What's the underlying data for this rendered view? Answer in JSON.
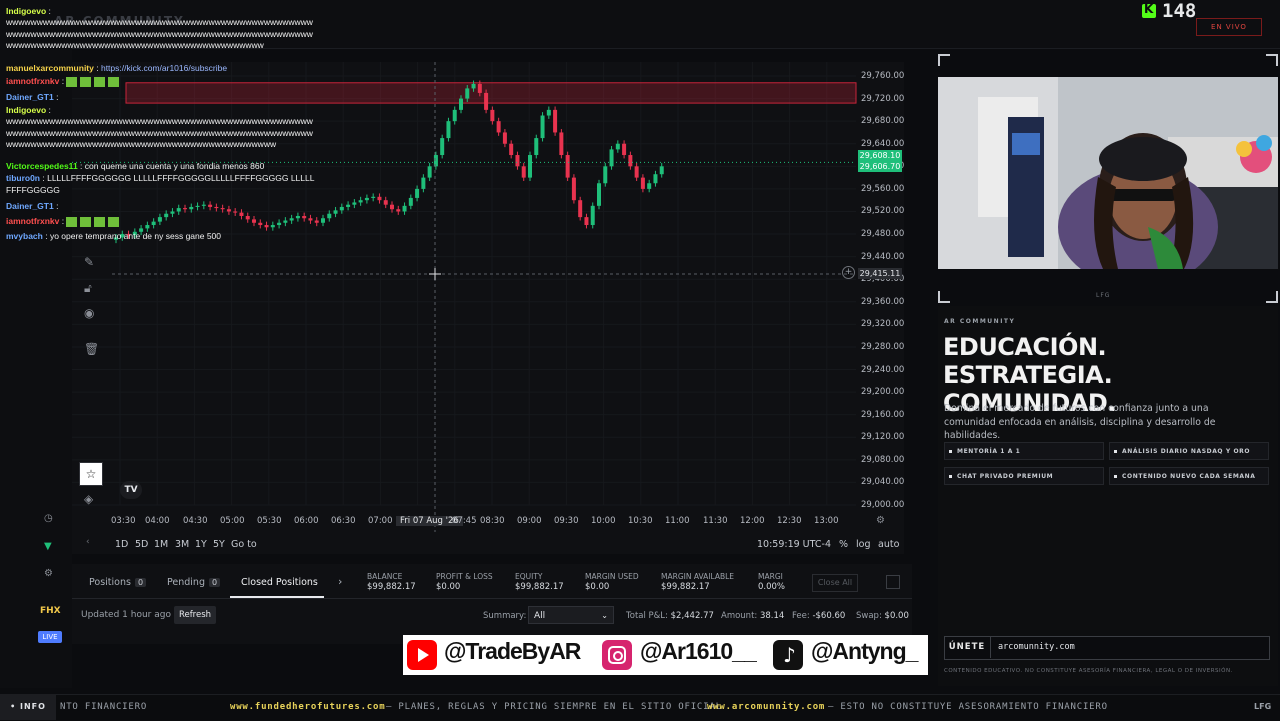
{
  "header": {
    "brand_faint": "AR COMMUNITY",
    "viewer_count": "148",
    "live_badge": "EN VIVO"
  },
  "chat": [
    {
      "user": "Indigoevo",
      "color": "#d7ff4a",
      "msg": ""
    },
    {
      "user": "",
      "color": "#ffffff",
      "msg": "wwwwwwwwwwwwwwwwwwwwwwwwwwwwwwwwwwwwwwwwwwwwwwwwwwwwwwwwwwwwwwwwwwwwwwwwwwwwwwwwwwwwwwwwwwwwwwwwwwwwwwwwwwwwwwwwwwwwwwwwwwwwwwwwwwwwwwwwwwwwww"
    },
    {
      "user": "manuelxarcommunity",
      "color": "#f5d24a",
      "msg": "https://kick.com/ar1016/subscribe"
    },
    {
      "user": "iamnotfrxnkv",
      "color": "#ff4f4f",
      "msg": "emotes"
    },
    {
      "user": "Dainer_GT1",
      "color": "#6fa8ff",
      "msg": ""
    },
    {
      "user": "Indigoevo",
      "color": "#d7ff4a",
      "msg": ""
    },
    {
      "user": "",
      "color": "#ffffff",
      "msg": "wwwwwwwwwwwwwwwwwwwwwwwwwwwwwwwwwwwwwwwwwwwwwwwwwwwwwwwwwwwwwwwwwwwwwwwwwwwwwwwwwwwwwwwwwwwwwwwwwwwwwwwwwwwwwwwwwwwwwwwwwwwwwwwwwwwwwwwwwwwwwwww"
    },
    {
      "user": "Victorcespedes11",
      "color": "#53fc18",
      "msg": "con queme una cuenta y una fondia menos 860"
    },
    {
      "user": "tiburo0n",
      "color": "#6fa8ff",
      "msg": "LLLLLFFFFGGGGGG LLLLLFFFFGGGGGLLLLLFFFFGGGGG LLLLLFFFFGGGGG"
    },
    {
      "user": "Dainer_GT1",
      "color": "#6fa8ff",
      "msg": ""
    },
    {
      "user": "iamnotfrxnkv",
      "color": "#ff4f4f",
      "msg": "emotes"
    },
    {
      "user": "mvybach",
      "color": "#6fa8ff",
      "msg": "yo opere temprano ante de ny sess gane 500"
    }
  ],
  "chart_data": {
    "type": "candlestick",
    "x_ticks": [
      "03:30",
      "04:00",
      "04:30",
      "05:00",
      "05:30",
      "06:00",
      "06:30",
      "07:00",
      "Fri 07 Aug '26",
      "07:45",
      "08:30",
      "09:00",
      "09:30",
      "10:00",
      "10:30",
      "11:00",
      "11:30",
      "12:00",
      "12:30",
      "13:00"
    ],
    "y_ticks": [
      "29,760.00",
      "29,720.00",
      "29,680.00",
      "29,640.00",
      "29,600.00",
      "29,560.00",
      "29,520.00",
      "29,480.00",
      "29,440.00",
      "29,400.00",
      "29,360.00",
      "29,320.00",
      "29,280.00",
      "29,240.00",
      "29,200.00",
      "29,160.00",
      "29,120.00",
      "29,080.00",
      "29,040.00",
      "29,000.00"
    ],
    "ylim": [
      29000,
      29760
    ],
    "price_badges": [
      "29,608.10",
      "29,606.70"
    ],
    "crosshair_price": "29,415.11",
    "zone": [
      29712,
      29748
    ],
    "colors": {
      "up": "#1fbf7a",
      "down": "#e8334f",
      "zone": "#c8243a"
    },
    "closes": [
      29474,
      29480,
      29478,
      29484,
      29490,
      29496,
      29502,
      29510,
      29516,
      29520,
      29526,
      29524,
      29528,
      29530,
      29532,
      29528,
      29526,
      29524,
      29520,
      29518,
      29512,
      29506,
      29500,
      29496,
      29492,
      29496,
      29500,
      29504,
      29508,
      29512,
      29508,
      29504,
      29500,
      29508,
      29516,
      29522,
      29528,
      29532,
      29536,
      29540,
      29544,
      29546,
      29540,
      29532,
      29524,
      29520,
      29530,
      29544,
      29560,
      29580,
      29600,
      29620,
      29650,
      29680,
      29700,
      29720,
      29738,
      29746,
      29730,
      29700,
      29680,
      29660,
      29640,
      29620,
      29600,
      29580,
      29620,
      29650,
      29690,
      29700,
      29660,
      29620,
      29580,
      29540,
      29510,
      29496,
      29530,
      29570,
      29600,
      29630,
      29640,
      29620,
      29600,
      29580,
      29560,
      29570,
      29586,
      29600
    ]
  },
  "toolbar": {
    "ranges": [
      "1D",
      "5D",
      "1M",
      "3M",
      "1Y",
      "5Y"
    ],
    "goto": "Go to",
    "clock": "10:59:19 UTC-4",
    "pct": "%",
    "log": "log",
    "auto": "auto"
  },
  "panel": {
    "tabs": [
      {
        "label": "Positions",
        "count": "0"
      },
      {
        "label": "Pending",
        "count": "0"
      },
      {
        "label": "Closed Positions",
        "count": ""
      }
    ],
    "stats": [
      {
        "label": "BALANCE",
        "value": "$99,882.17"
      },
      {
        "label": "PROFIT & LOSS",
        "value": "$0.00"
      },
      {
        "label": "EQUITY",
        "value": "$99,882.17"
      },
      {
        "label": "MARGIN USED",
        "value": "$0.00"
      },
      {
        "label": "MARGIN AVAILABLE",
        "value": "$99,882.17"
      },
      {
        "label": "MARGI",
        "value": "0.00%"
      }
    ],
    "close_all": "Close All",
    "updated": "Updated 1 hour ago",
    "refresh": "Refresh",
    "summary_label": "Summary:",
    "summary_value": "All",
    "total_pl_label": "Total P&L:",
    "total_pl": "$2,442.77",
    "amount_label": "Amount:",
    "amount": "38.14",
    "fee_label": "Fee:",
    "fee": "-$60.60",
    "swap_label": "Swap:",
    "swap": "$0.00"
  },
  "left_badges": {
    "fhx": "FHX",
    "live": "LIVE"
  },
  "socials": [
    {
      "handle": "@TradeByAR",
      "icon": "youtube-icon",
      "color": "#ff0000"
    },
    {
      "handle": "@Ar1610__",
      "icon": "instagram-icon",
      "color": "#d6246e"
    },
    {
      "handle": "@Antyng_",
      "icon": "tiktok-icon",
      "color": "#111111"
    }
  ],
  "promo": {
    "small_top": "LFG",
    "tag": "AR COMMUNITY",
    "title_line1": "EDUCACIÓN. ESTRATEGIA.",
    "title_line2": "COMUNIDAD.",
    "desc": "Domina el mercado de futuros con confianza junto a una comunidad enfocada en análisis, disciplina y desarrollo de habilidades.",
    "features": [
      "MENTORÍA 1 A 1",
      "ANÁLISIS DIARIO NASDAQ Y ORO",
      "CHAT PRIVADO PREMIUM",
      "CONTENIDO NUEVO CADA SEMANA"
    ],
    "join_label": "ÚNETE",
    "join_url": "arcomunnity.com",
    "disclaimer": "CONTENIDO EDUCATIVO. NO CONSTITUYE ASESORÍA FINANCIERA, LEGAL O DE INVERSIÓN."
  },
  "ticker": {
    "badge": "• INFO",
    "items": [
      {
        "text": "NTO FINANCIERO",
        "bold": false
      },
      {
        "text": "www.fundedherofutures.com",
        "bold": true
      },
      {
        "text": "— PLANES, REGLAS Y PRICING SIEMPRE EN EL SITIO OFICIAL",
        "bold": false
      },
      {
        "text": "www.arcomunnity.com",
        "bold": true
      },
      {
        "text": "— ESTO NO CONSTITUYE ASESORAMIENTO FINANCIERO",
        "bold": false
      }
    ],
    "end": "LFG"
  }
}
